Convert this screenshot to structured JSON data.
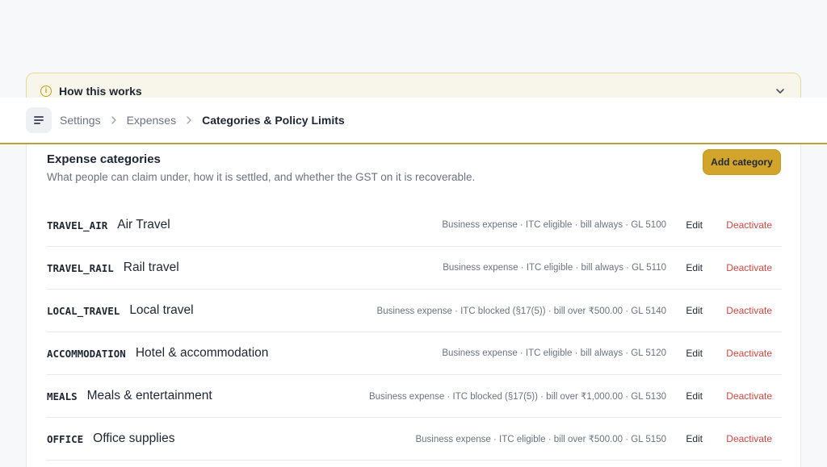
{
  "banner": {
    "title": "How this works"
  },
  "breadcrumb": {
    "items": [
      "Settings",
      "Expenses"
    ],
    "current": "Categories & Policy Limits"
  },
  "panel": {
    "title": "Expense categories",
    "subtitle": "What people can claim under, how it is settled, and whether the GST on it is recoverable.",
    "add_button": "Add category"
  },
  "actions": {
    "edit": "Edit",
    "deactivate": "Deactivate"
  },
  "categories": [
    {
      "code": "TRAVEL_AIR",
      "name": "Air Travel",
      "meta": "Business expense · ITC eligible · bill always · GL 5100"
    },
    {
      "code": "TRAVEL_RAIL",
      "name": "Rail travel",
      "meta": "Business expense · ITC eligible · bill always · GL 5110"
    },
    {
      "code": "LOCAL_TRAVEL",
      "name": "Local travel",
      "meta": "Business expense · ITC blocked (§17(5)) · bill over ₹500.00 · GL 5140"
    },
    {
      "code": "ACCOMMODATION",
      "name": "Hotel & accommodation",
      "meta": "Business expense · ITC eligible · bill always · GL 5120"
    },
    {
      "code": "MEALS",
      "name": "Meals & entertainment",
      "meta": "Business expense · ITC blocked (§17(5)) · bill over ₹1,000.00 · GL 5130"
    },
    {
      "code": "OFFICE",
      "name": "Office supplies",
      "meta": "Business expense · ITC eligible · bill over ₹500.00 · GL 5150"
    }
  ],
  "colors": {
    "accent": "#d2a52a",
    "danger": "#d6453d",
    "banner_bg": "#f8f6ea"
  }
}
